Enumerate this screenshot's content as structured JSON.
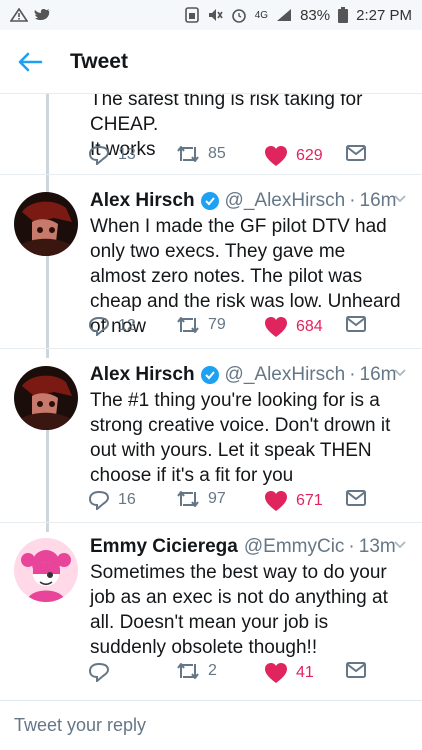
{
  "statusbar": {
    "battery": "83%",
    "time": "2:27 PM",
    "network": "4G"
  },
  "appbar": {
    "title": "Tweet"
  },
  "tweets": [
    {
      "text": "The safest thing is risk taking for CHEAP.\nIt works",
      "replies": "13",
      "retweets": "85",
      "likes": "629"
    },
    {
      "name": "Alex Hirsch",
      "handle": "@_AlexHirsch",
      "time": "16m",
      "text": "When I made the GF pilot DTV had only two execs. They gave me almost zero notes. The pilot was cheap and the risk was low. Unheard of now",
      "replies": "12",
      "retweets": "79",
      "likes": "684"
    },
    {
      "name": "Alex Hirsch",
      "handle": "@_AlexHirsch",
      "time": "16m",
      "text": "The #1 thing you're looking for is a strong creative voice. Don't drown it out with yours. Let it speak THEN choose if it's a fit for you",
      "replies": "16",
      "retweets": "97",
      "likes": "671"
    },
    {
      "name": "Emmy Cicierega",
      "handle": "@EmmyCic",
      "time": "13m",
      "text": "Sometimes the best way to do your job as an exec is not do anything at all. Doesn't mean your job is suddenly obsolete though!!",
      "replies": "",
      "retweets": "2",
      "likes": "41"
    }
  ],
  "separator": "·",
  "reply_bar": {
    "placeholder": "Tweet your reply"
  },
  "colors": {
    "accent": "#1da1f2",
    "like": "#e0245e",
    "muted": "#657786",
    "thread_line": "#ccd6dd"
  },
  "icons": [
    "back-arrow-icon",
    "reply-icon",
    "retweet-icon",
    "heart-icon",
    "message-icon",
    "verified-icon",
    "chevron-down-icon"
  ]
}
